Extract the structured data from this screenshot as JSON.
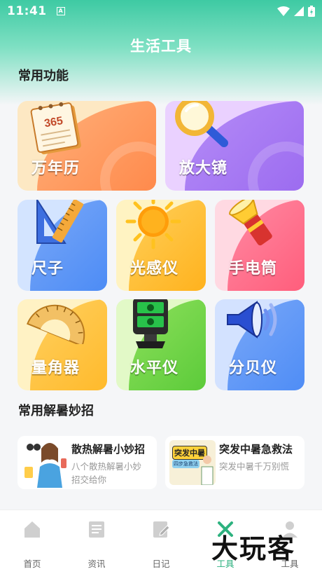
{
  "status_bar": {
    "time": "11:41",
    "badge": "A"
  },
  "header": {
    "title": "生活工具"
  },
  "sections": {
    "common_functions": "常用功能",
    "summer_tips": "常用解暑妙招"
  },
  "tools": [
    {
      "id": "calendar",
      "label": "万年历",
      "icon": "calendar-icon",
      "colors": [
        "#fde7b8",
        "#ff8a4c"
      ]
    },
    {
      "id": "magnifier",
      "label": "放大镜",
      "icon": "magnifier-icon",
      "colors": [
        "#e9c9ff",
        "#9c6cf0"
      ]
    },
    {
      "id": "ruler",
      "label": "尺子",
      "icon": "ruler-icon",
      "colors": [
        "#c6dcff",
        "#4d8cf5"
      ]
    },
    {
      "id": "light-meter",
      "label": "光感仪",
      "icon": "sun-icon",
      "colors": [
        "#fff1b3",
        "#ffb21e"
      ]
    },
    {
      "id": "flashlight",
      "label": "手电筒",
      "icon": "flashlight-icon",
      "colors": [
        "#ffd0db",
        "#ff5e7c"
      ]
    },
    {
      "id": "protractor",
      "label": "量角器",
      "icon": "protractor-icon",
      "colors": [
        "#fff0b8",
        "#ffba2c"
      ]
    },
    {
      "id": "level",
      "label": "水平仪",
      "icon": "laser-level-icon",
      "colors": [
        "#d8f7b5",
        "#5ccb3a"
      ]
    },
    {
      "id": "decibel",
      "label": "分贝仪",
      "icon": "speaker-icon",
      "colors": [
        "#c9ddff",
        "#4f8df6"
      ]
    }
  ],
  "tips": [
    {
      "title": "散热解暑小妙招",
      "desc_line1": "八个散热解暑小妙",
      "desc_line2": "招交给你"
    },
    {
      "title": "突发中暑急救法",
      "desc_line1": "突发中暑千万别慌",
      "thumb_line1": "突发中暑",
      "thumb_line2": "四步急救法"
    }
  ],
  "nav": [
    {
      "label": "首页",
      "icon": "home-icon"
    },
    {
      "label": "资讯",
      "icon": "news-icon"
    },
    {
      "label": "日记",
      "icon": "diary-icon"
    },
    {
      "label": "工具",
      "icon": "tools-icon",
      "active": true
    },
    {
      "label": "工具",
      "icon": "user-icon"
    }
  ],
  "watermark": "大玩客",
  "accent_color": "#2db27f"
}
